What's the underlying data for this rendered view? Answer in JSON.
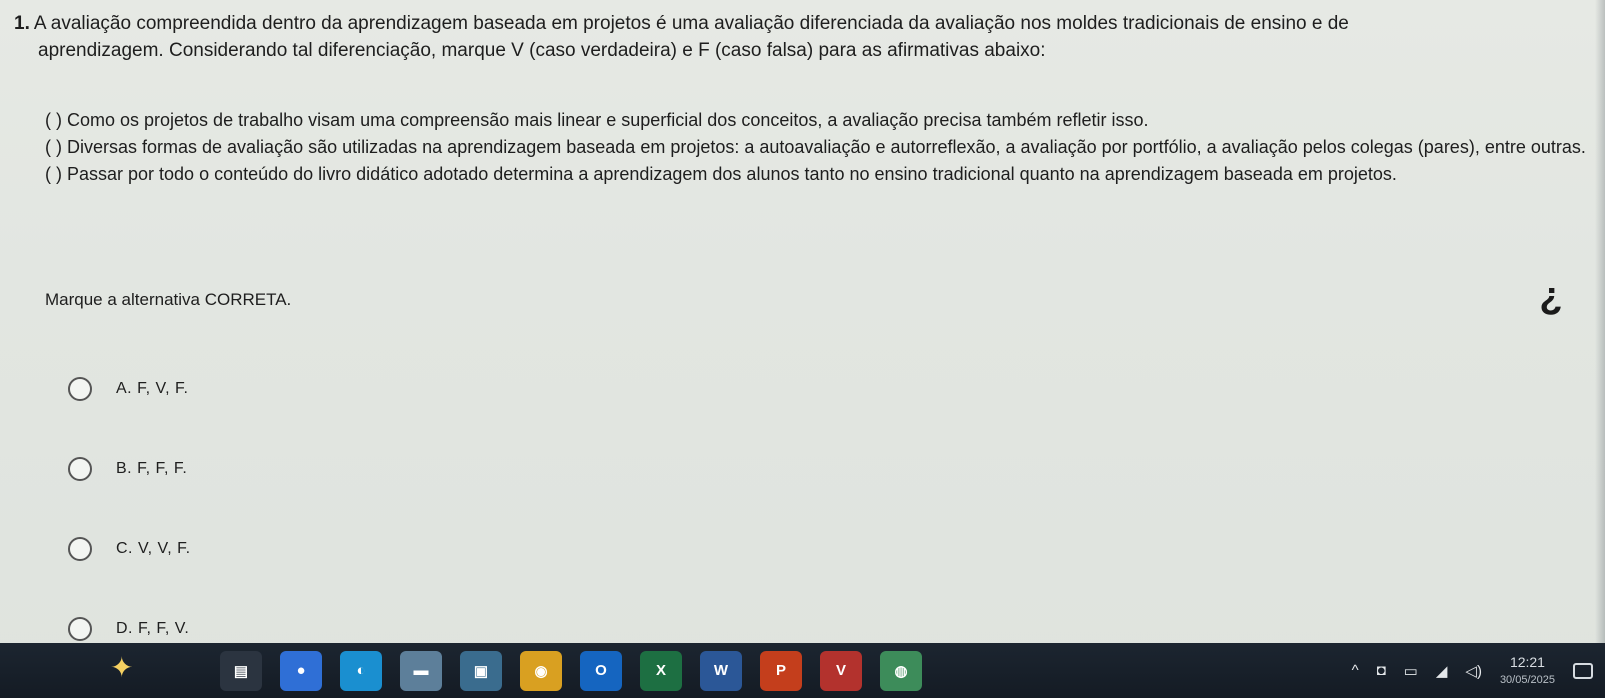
{
  "question": {
    "number": "1.",
    "line1": "A avaliação compreendida dentro da aprendizagem baseada em projetos é uma avaliação diferenciada da avaliação nos moldes tradicionais de ensino e de",
    "line2": "aprendizagem. Considerando tal diferenciação, marque V (caso verdadeira) e F (caso falsa) para as afirmativas abaixo:"
  },
  "statements": [
    "( ) Como os projetos de trabalho visam uma compreensão mais linear e superficial dos conceitos, a avaliação precisa também refletir isso.",
    "( ) Diversas formas de avaliação são utilizadas na aprendizagem baseada em projetos: a autoavaliação e autorreflexão, a avaliação por portfólio, a avaliação pelos colegas (pares), entre outras.",
    "( ) Passar por todo o conteúdo do livro didático adotado determina a aprendizagem dos alunos tanto no ensino tradicional quanto na aprendizagem baseada em projetos."
  ],
  "prompt": "Marque a alternativa CORRETA.",
  "options": [
    {
      "label": "A. F, V, F."
    },
    {
      "label": "B. F, F, F."
    },
    {
      "label": "C. V, V, F."
    },
    {
      "label": "D. F, F, V."
    }
  ],
  "help_icon": "help-question-icon",
  "taskbar": {
    "start_icon": "sparkle-icon",
    "apps": [
      {
        "name": "calendar-icon",
        "text": "▤",
        "color": "#2b3440"
      },
      {
        "name": "browser-blue-icon",
        "text": "●",
        "color": "#2f6fd6"
      },
      {
        "name": "edge-icon",
        "text": "◐",
        "color": "#1a8fd0"
      },
      {
        "name": "photos-icon",
        "text": "▬",
        "color": "#5d7f9a"
      },
      {
        "name": "store-icon",
        "text": "▣",
        "color": "#3a6c8e"
      },
      {
        "name": "chrome-icon",
        "text": "◉",
        "color": "#d9a021"
      },
      {
        "name": "outlook-icon",
        "text": "O",
        "color": "#1565c0"
      },
      {
        "name": "excel-icon",
        "text": "X",
        "color": "#1d6f42"
      },
      {
        "name": "word-icon",
        "text": "W",
        "color": "#2b5797"
      },
      {
        "name": "powerpoint-icon",
        "text": "P",
        "color": "#c43e1c"
      },
      {
        "name": "vivaldi-icon",
        "text": "V",
        "color": "#b3322d"
      },
      {
        "name": "globe-icon",
        "text": "◍",
        "color": "#3d8c5a"
      }
    ],
    "tray": {
      "chevron": "^",
      "time": "12:21",
      "date": "30/05/2025"
    }
  }
}
